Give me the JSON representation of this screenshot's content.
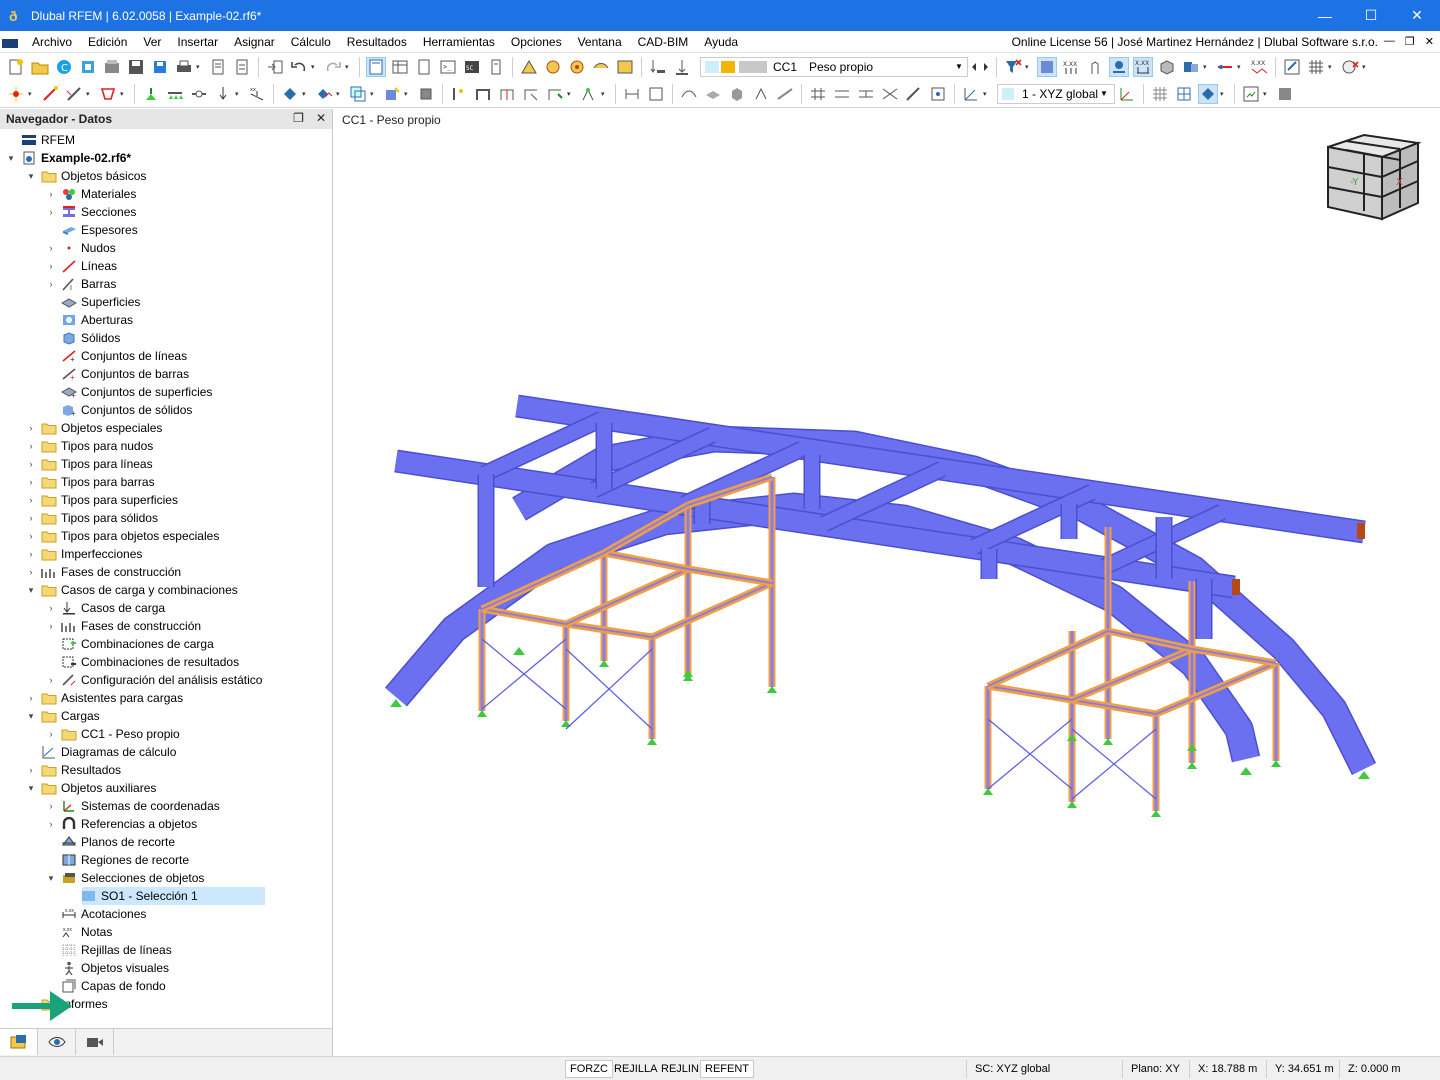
{
  "titlebar": {
    "title": "Dlubal RFEM | 6.02.0058 | Example-02.rf6*",
    "minimize": "—",
    "maximize": "☐",
    "close": "✕"
  },
  "menubar": {
    "items": [
      "Archivo",
      "Edición",
      "Ver",
      "Insertar",
      "Asignar",
      "Cálculo",
      "Resultados",
      "Herramientas",
      "Opciones",
      "Ventana",
      "CAD-BIM",
      "Ayuda"
    ],
    "license": "Online License 56 | José Martinez Hernández | Dlubal Software s.r.o."
  },
  "toolbar": {
    "load_case_code": "CC1",
    "load_case_name": "Peso propio",
    "coord_system": "1 - XYZ global"
  },
  "navigator": {
    "title": "Navegador - Datos",
    "tree": [
      {
        "label": "RFEM",
        "level": 0,
        "exp": "",
        "icon": "rfem-icon"
      },
      {
        "label": "Example-02.rf6*",
        "level": 0,
        "exp": "▾",
        "icon": "model-file-icon",
        "bold": true
      },
      {
        "label": "Objetos básicos",
        "level": 1,
        "exp": "▾",
        "icon": "folder-icon"
      },
      {
        "label": "Materiales",
        "level": 2,
        "exp": "›",
        "icon": "materials-icon"
      },
      {
        "label": "Secciones",
        "level": 2,
        "exp": "›",
        "icon": "sections-icon"
      },
      {
        "label": "Espesores",
        "level": 2,
        "exp": "",
        "icon": "thickness-icon"
      },
      {
        "label": "Nudos",
        "level": 2,
        "exp": "›",
        "icon": "node-icon"
      },
      {
        "label": "Líneas",
        "level": 2,
        "exp": "›",
        "icon": "line-icon"
      },
      {
        "label": "Barras",
        "level": 2,
        "exp": "›",
        "icon": "member-icon"
      },
      {
        "label": "Superficies",
        "level": 2,
        "exp": "",
        "icon": "surface-icon"
      },
      {
        "label": "Aberturas",
        "level": 2,
        "exp": "",
        "icon": "opening-icon"
      },
      {
        "label": "Sólidos",
        "level": 2,
        "exp": "",
        "icon": "solid-icon"
      },
      {
        "label": "Conjuntos de líneas",
        "level": 2,
        "exp": "",
        "icon": "line-set-icon"
      },
      {
        "label": "Conjuntos de barras",
        "level": 2,
        "exp": "",
        "icon": "member-set-icon"
      },
      {
        "label": "Conjuntos de superficies",
        "level": 2,
        "exp": "",
        "icon": "surface-set-icon"
      },
      {
        "label": "Conjuntos de sólidos",
        "level": 2,
        "exp": "",
        "icon": "solid-set-icon"
      },
      {
        "label": "Objetos especiales",
        "level": 1,
        "exp": "›",
        "icon": "folder-icon"
      },
      {
        "label": "Tipos para nudos",
        "level": 1,
        "exp": "›",
        "icon": "folder-icon"
      },
      {
        "label": "Tipos para líneas",
        "level": 1,
        "exp": "›",
        "icon": "folder-icon"
      },
      {
        "label": "Tipos para barras",
        "level": 1,
        "exp": "›",
        "icon": "folder-icon"
      },
      {
        "label": "Tipos para superficies",
        "level": 1,
        "exp": "›",
        "icon": "folder-icon"
      },
      {
        "label": "Tipos para sólidos",
        "level": 1,
        "exp": "›",
        "icon": "folder-icon"
      },
      {
        "label": "Tipos para objetos especiales",
        "level": 1,
        "exp": "›",
        "icon": "folder-icon"
      },
      {
        "label": "Imperfecciones",
        "level": 1,
        "exp": "›",
        "icon": "folder-icon"
      },
      {
        "label": "Fases de construcción",
        "level": 1,
        "exp": "›",
        "icon": "construction-stages-icon"
      },
      {
        "label": "Casos de carga y combinaciones",
        "level": 1,
        "exp": "▾",
        "icon": "folder-icon"
      },
      {
        "label": "Casos de carga",
        "level": 2,
        "exp": "›",
        "icon": "load-case-icon"
      },
      {
        "label": "Fases de construcción",
        "level": 2,
        "exp": "›",
        "icon": "construction-stages-icon"
      },
      {
        "label": "Combinaciones de carga",
        "level": 2,
        "exp": "",
        "icon": "load-combination-icon"
      },
      {
        "label": "Combinaciones de resultados",
        "level": 2,
        "exp": "",
        "icon": "result-combination-icon"
      },
      {
        "label": "Configuración del análisis estático",
        "level": 2,
        "exp": "›",
        "icon": "static-analysis-icon"
      },
      {
        "label": "Asistentes para cargas",
        "level": 1,
        "exp": "›",
        "icon": "folder-icon"
      },
      {
        "label": "Cargas",
        "level": 1,
        "exp": "▾",
        "icon": "folder-icon"
      },
      {
        "label": "CC1 - Peso propio",
        "level": 2,
        "exp": "›",
        "icon": "folder-icon"
      },
      {
        "label": "Diagramas de cálculo",
        "level": 1,
        "exp": "",
        "icon": "diagram-icon"
      },
      {
        "label": "Resultados",
        "level": 1,
        "exp": "›",
        "icon": "folder-icon"
      },
      {
        "label": "Objetos auxiliares",
        "level": 1,
        "exp": "▾",
        "icon": "folder-icon"
      },
      {
        "label": "Sistemas de coordenadas",
        "level": 2,
        "exp": "›",
        "icon": "coordinate-system-icon"
      },
      {
        "label": "Referencias a objetos",
        "level": 2,
        "exp": "›",
        "icon": "object-snap-icon"
      },
      {
        "label": "Planos de recorte",
        "level": 2,
        "exp": "",
        "icon": "clipping-plane-icon"
      },
      {
        "label": "Regiones de recorte",
        "level": 2,
        "exp": "",
        "icon": "clipping-box-icon"
      },
      {
        "label": "Selecciones de objetos",
        "level": 2,
        "exp": "▾",
        "icon": "object-selection-icon"
      },
      {
        "label": "SO1 - Selección 1",
        "level": 3,
        "exp": "",
        "icon": "selection-swatch-icon",
        "selected": true
      },
      {
        "label": "Acotaciones",
        "level": 2,
        "exp": "",
        "icon": "dimension-icon"
      },
      {
        "label": "Notas",
        "level": 2,
        "exp": "",
        "icon": "note-icon"
      },
      {
        "label": "Rejillas de líneas",
        "level": 2,
        "exp": "",
        "icon": "line-grid-icon"
      },
      {
        "label": "Objetos visuales",
        "level": 2,
        "exp": "",
        "icon": "visual-object-icon"
      },
      {
        "label": "Capas de fondo",
        "level": 2,
        "exp": "",
        "icon": "background-layer-icon"
      },
      {
        "label": "Informes",
        "level": 1,
        "exp": "",
        "icon": "folder-icon"
      }
    ]
  },
  "viewport": {
    "title": "CC1 - Peso propio",
    "viewcube_labels": {
      "minus_y": "-Y",
      "x": "X"
    }
  },
  "statusbar": {
    "toggles": [
      {
        "label": "FORZC",
        "active": true
      },
      {
        "label": "REJILLA",
        "active": false
      },
      {
        "label": "REJLIN",
        "active": false
      },
      {
        "label": "REFENT",
        "active": true
      }
    ],
    "coord_system": "SC: XYZ global",
    "plane": "Plano: XY",
    "x": "X: 18.788 m",
    "y": "Y: 34.651 m",
    "z": "Z: 0.000 m"
  },
  "colors": {
    "titlebar": "#1e73e4",
    "member_fill": "#6b70f0",
    "member_edge": "#4a4fd0",
    "scaffold_orange": "#f0a040",
    "support_green": "#3ec93e",
    "selection_highlight": "#cce8ff",
    "arrow": "#1aa37a"
  }
}
